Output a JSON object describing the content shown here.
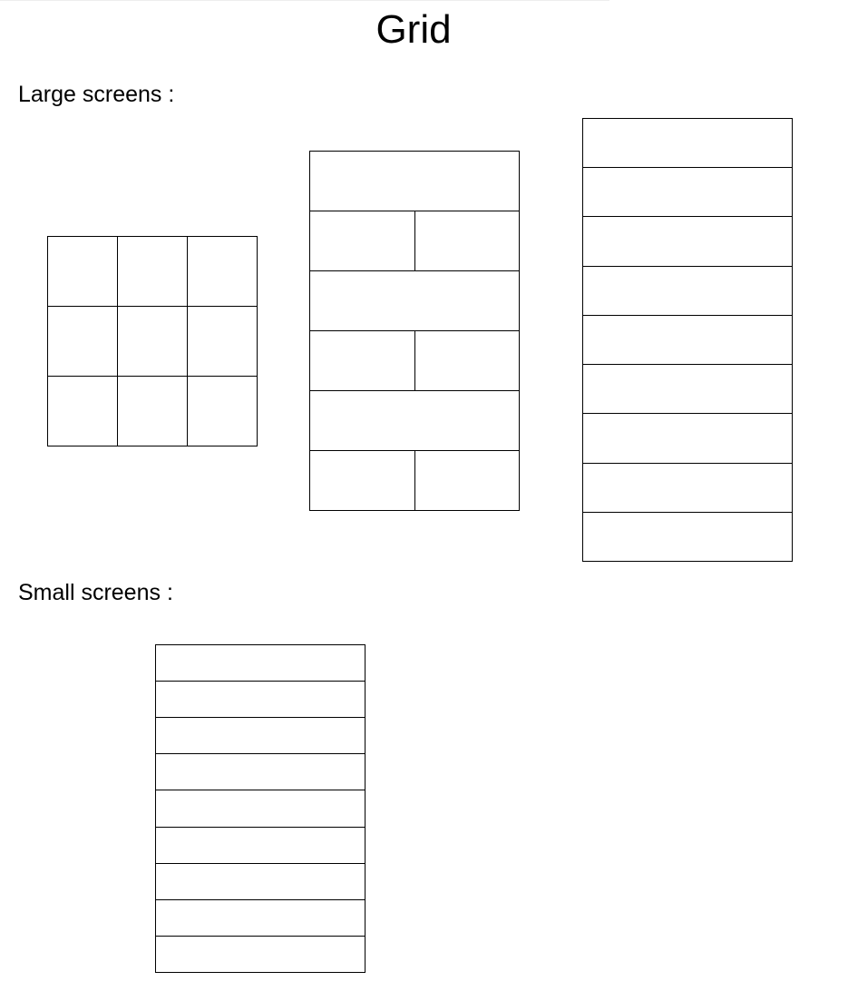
{
  "title": "Grid",
  "sections": {
    "large": {
      "label": "Large screens :",
      "layouts": [
        {
          "name": "three-by-three",
          "rows": [
            3,
            3,
            3
          ]
        },
        {
          "name": "alternating",
          "rows": [
            1,
            2,
            1,
            2,
            1,
            2
          ]
        },
        {
          "name": "single-column",
          "rows": [
            1,
            1,
            1,
            1,
            1,
            1,
            1,
            1,
            1
          ]
        }
      ]
    },
    "small": {
      "label": "Small screens :",
      "layouts": [
        {
          "name": "single-column",
          "rows": [
            1,
            1,
            1,
            1,
            1,
            1,
            1,
            1,
            1
          ]
        }
      ]
    }
  }
}
